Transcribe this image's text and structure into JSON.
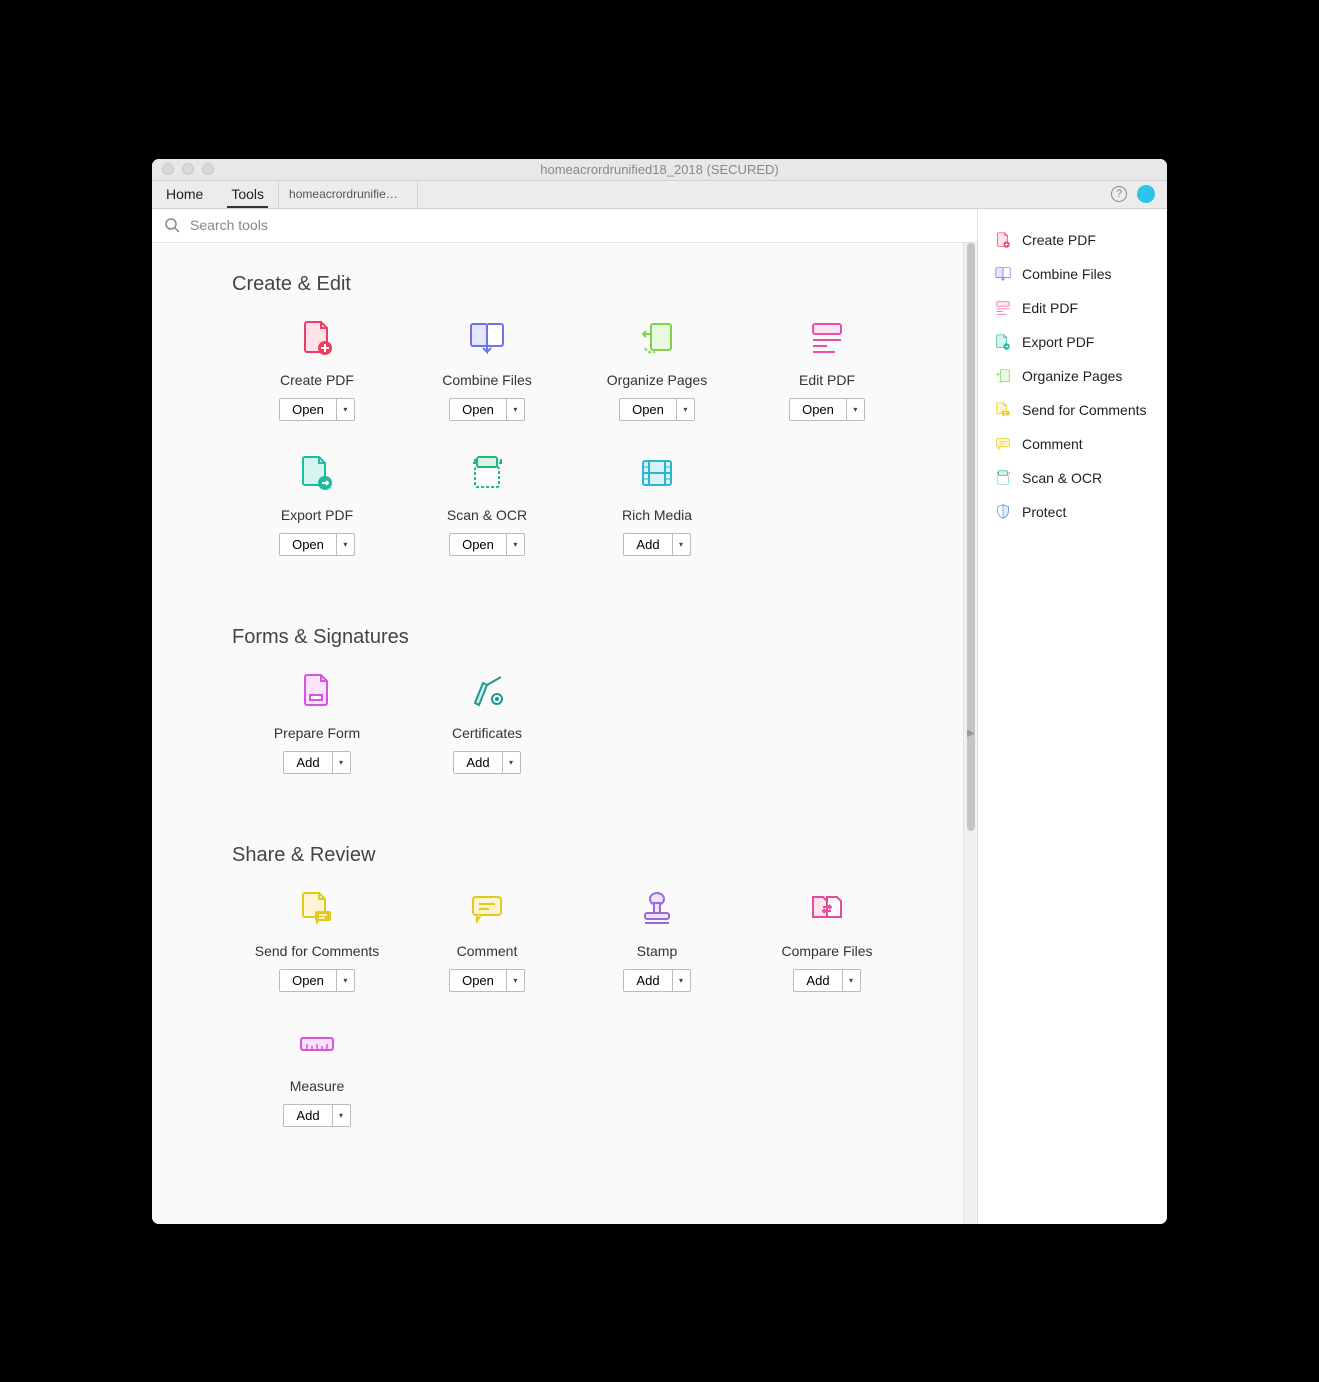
{
  "window": {
    "title": "homeacrordrunified18_2018 (SECURED)"
  },
  "tabs": {
    "home": "Home",
    "tools": "Tools",
    "doc": "homeacrordrunifie…"
  },
  "search": {
    "placeholder": "Search tools"
  },
  "sections": [
    {
      "title": "Create & Edit",
      "tools": [
        {
          "name": "create-pdf",
          "label": "Create PDF",
          "action": "Open",
          "color": "#ed3d63"
        },
        {
          "name": "combine-files",
          "label": "Combine Files",
          "action": "Open",
          "color": "#6b74e8"
        },
        {
          "name": "organize-pages",
          "label": "Organize Pages",
          "action": "Open",
          "color": "#7dd24b"
        },
        {
          "name": "edit-pdf",
          "label": "Edit PDF",
          "action": "Open",
          "color": "#ed4fa4"
        },
        {
          "name": "export-pdf",
          "label": "Export PDF",
          "action": "Open",
          "color": "#1ebba3"
        },
        {
          "name": "scan-ocr",
          "label": "Scan & OCR",
          "action": "Open",
          "color": "#20b876"
        },
        {
          "name": "rich-media",
          "label": "Rich Media",
          "action": "Add",
          "color": "#2bb6cf"
        }
      ]
    },
    {
      "title": "Forms & Signatures",
      "tools": [
        {
          "name": "prepare-form",
          "label": "Prepare Form",
          "action": "Add",
          "color": "#d554e0"
        },
        {
          "name": "certificates",
          "label": "Certificates",
          "action": "Add",
          "color": "#1a9a91"
        }
      ]
    },
    {
      "title": "Share & Review",
      "tools": [
        {
          "name": "send-for-comments",
          "label": "Send for Comments",
          "action": "Open",
          "color": "#e5c81d"
        },
        {
          "name": "comment",
          "label": "Comment",
          "action": "Open",
          "color": "#e5c81d"
        },
        {
          "name": "stamp",
          "label": "Stamp",
          "action": "Add",
          "color": "#9b6ad6"
        },
        {
          "name": "compare-files",
          "label": "Compare Files",
          "action": "Add",
          "color": "#e84b9a"
        },
        {
          "name": "measure",
          "label": "Measure",
          "action": "Add",
          "color": "#d554e0"
        }
      ]
    }
  ],
  "sidebar": [
    {
      "name": "create-pdf",
      "label": "Create PDF",
      "color": "#ed3d63"
    },
    {
      "name": "combine-files",
      "label": "Combine Files",
      "color": "#6b74e8"
    },
    {
      "name": "edit-pdf",
      "label": "Edit PDF",
      "color": "#ed4fa4"
    },
    {
      "name": "export-pdf",
      "label": "Export PDF",
      "color": "#1ebba3"
    },
    {
      "name": "organize-pages",
      "label": "Organize Pages",
      "color": "#7dd24b"
    },
    {
      "name": "send-for-comments",
      "label": "Send for Comments",
      "color": "#e5c81d"
    },
    {
      "name": "comment",
      "label": "Comment",
      "color": "#e5c81d"
    },
    {
      "name": "scan-ocr",
      "label": "Scan & OCR",
      "color": "#20b876"
    },
    {
      "name": "protect",
      "label": "Protect",
      "color": "#5b8de8"
    }
  ]
}
